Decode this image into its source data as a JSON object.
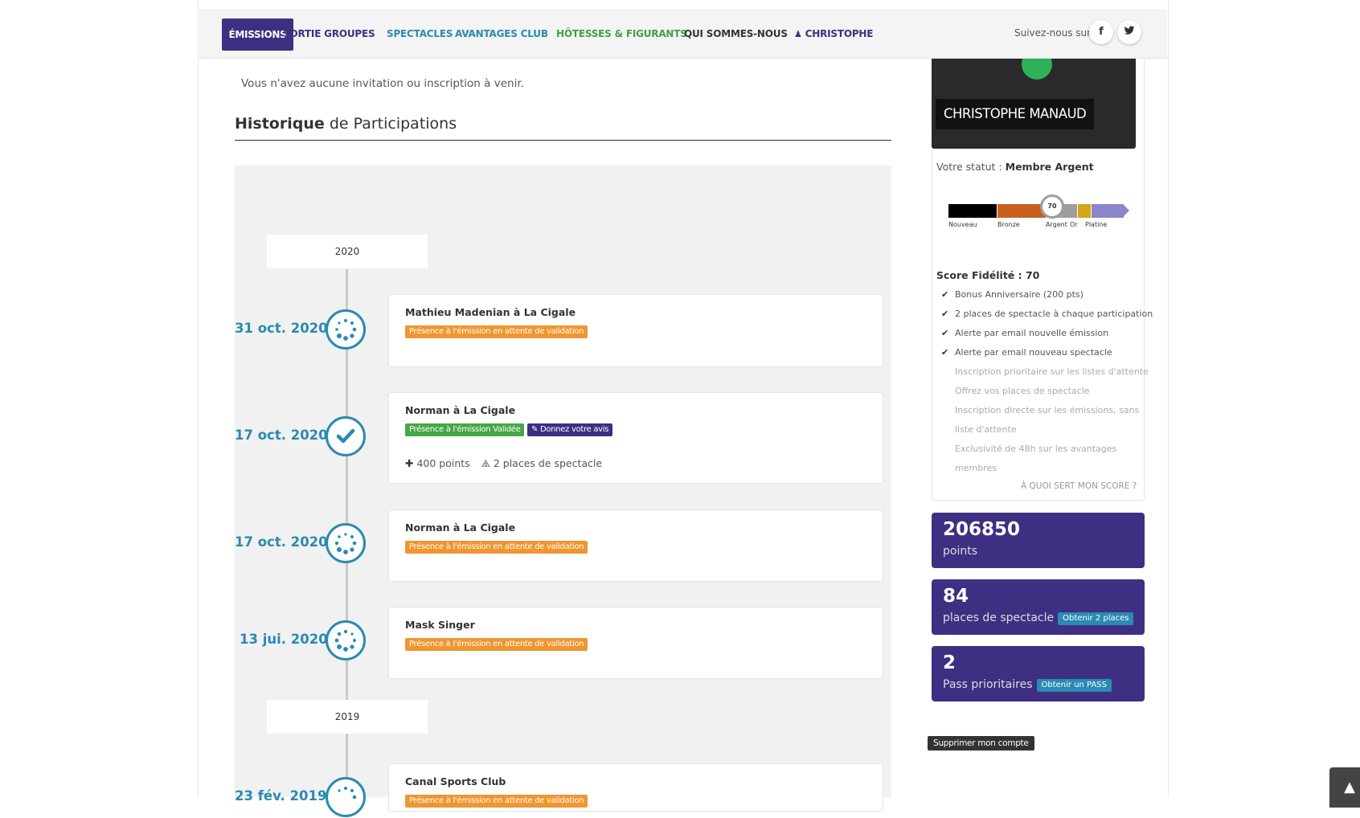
{
  "nav": {
    "active": "ÉMISSIONS",
    "items": [
      {
        "label": "SORTIE GROUPES",
        "color": "#3f2f83"
      },
      {
        "label": "SPECTACLES",
        "color": "#2a8ab2"
      },
      {
        "label": "AVANTAGES CLUB",
        "color": "#2a8ab2"
      },
      {
        "label": "HÔTESSES & FIGURANTS",
        "color": "#3fa144"
      },
      {
        "label": "QUI SOMMES-NOUS",
        "color": "#333333"
      },
      {
        "label": "CHRISTOPHE",
        "color": "#3f2f83"
      }
    ],
    "follow": "Suivez-nous sur",
    "facebook": "f",
    "twitter_icon": "twitter-bird"
  },
  "main": {
    "no_invite": "Vous n'avez aucune invitation ou inscription à venir.",
    "history_title_bold": "Historique",
    "history_title_rest": "de Participations"
  },
  "timeline": {
    "years": [
      "2020",
      "2019"
    ],
    "entries": [
      {
        "date": "31 oct. 2020",
        "title": "Mathieu Madenian à La Cigale",
        "badge": "Présence à l'émission en attente de validation",
        "status": "pending"
      },
      {
        "date": "17 oct. 2020",
        "title": "Norman à La Cigale",
        "badge": "Présence à l'émission Validée",
        "badge2": "Donnez votre avis",
        "points": "400 points",
        "places": "2 places de spectacle",
        "status": "validated"
      },
      {
        "date": "17 oct. 2020",
        "title": "Norman à La Cigale",
        "badge": "Présence à l'émission en attente de validation",
        "status": "pending"
      },
      {
        "date": "13 jui. 2020",
        "title": "Mask Singer",
        "badge": "Présence à l'émission en attente de validation",
        "status": "pending"
      },
      {
        "date": "23 fév. 2019",
        "title": "Canal Sports Club",
        "badge": "Présence à l'émission en attente de validation",
        "status": "pending"
      }
    ]
  },
  "profile": {
    "name": "CHRISTOPHE MANAUD",
    "status_label": "Votre statut :",
    "status_value": "Membre Argent",
    "gauge_value": "70",
    "gauge_levels": [
      "Nouveau",
      "Bronze",
      "Argent",
      "Or",
      "Platine"
    ],
    "score": "Score Fidélité : 70",
    "perks_active": [
      "Bonus Anniversaire (200 pts)",
      "2 places de spectacle à chaque participation",
      "Alerte par email nouvelle émission",
      "Alerte par email nouveau spectacle"
    ],
    "perks_inactive": [
      "Inscription prioritaire sur les listes d'attente",
      "Offrez vos places de spectacle",
      "Inscription directe sur les émissions, sans",
      "liste d'attente",
      "Exclusivité de 48h sur les avantages",
      "membres"
    ],
    "score_link": "À QUOI SERT MON SCORE ?"
  },
  "stats": [
    {
      "value": "206850",
      "label": "points",
      "button": ""
    },
    {
      "value": "84",
      "label": "places de spectacle",
      "button": "Obtenir 2 places"
    },
    {
      "value": "2",
      "label": "Pass prioritaires",
      "button": "Obtenir un PASS"
    }
  ],
  "delete_account": "Supprimer mon compte",
  "colors": {
    "primary": "#3f2f83",
    "accent": "#2a8ab2",
    "pending": "#ef9630",
    "validated": "#46a745"
  }
}
